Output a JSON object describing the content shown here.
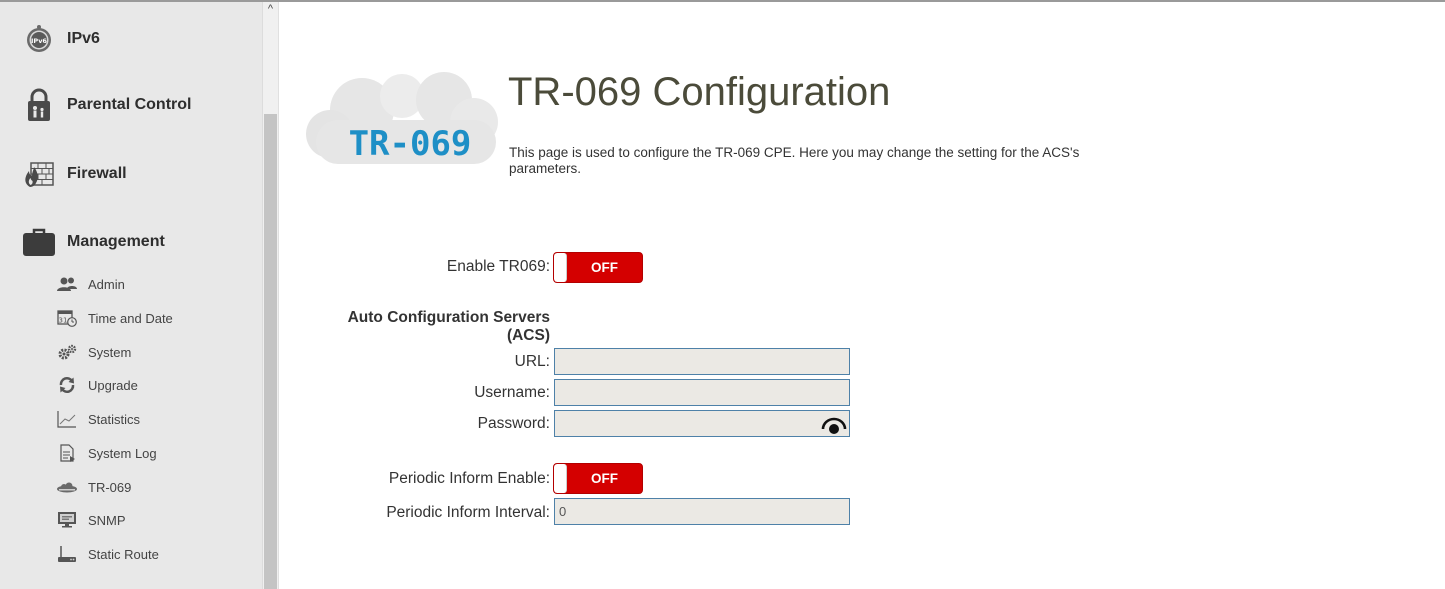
{
  "sidebar": {
    "sections": [
      {
        "label": "IPv6",
        "icon": "ipv6-globe-icon",
        "icon_text": "IPv6"
      },
      {
        "label": "Parental Control",
        "icon": "lock-family-icon"
      },
      {
        "label": "Firewall",
        "icon": "firewall-icon"
      },
      {
        "label": "Management",
        "icon": "briefcase-icon"
      }
    ],
    "management_items": [
      {
        "label": "Admin",
        "icon": "users-icon"
      },
      {
        "label": "Time and Date",
        "icon": "calendar-clock-icon",
        "icon_text": "31"
      },
      {
        "label": "System",
        "icon": "gears-icon"
      },
      {
        "label": "Upgrade",
        "icon": "refresh-icon"
      },
      {
        "label": "Statistics",
        "icon": "line-chart-icon"
      },
      {
        "label": "System Log",
        "icon": "log-file-icon"
      },
      {
        "label": "TR-069",
        "icon": "cloud-icon"
      },
      {
        "label": "SNMP",
        "icon": "monitor-icon"
      },
      {
        "label": "Static Route",
        "icon": "router-icon"
      }
    ],
    "scroll_up_glyph": "^"
  },
  "page": {
    "logo_text": "TR-069",
    "title": "TR-069 Configuration",
    "description": "This page is used to configure the TR-069 CPE. Here you may change the setting for the ACS's parameters."
  },
  "form": {
    "enable_label": "Enable TR069:",
    "enable_state": "OFF",
    "acs_heading_line1": "Auto Configuration Servers",
    "acs_heading_line2": "(ACS)",
    "url_label": "URL:",
    "url_value": "",
    "username_label": "Username:",
    "username_value": "",
    "password_label": "Password:",
    "password_value": "",
    "password_toggle_icon": "eye-icon",
    "periodic_enable_label": "Periodic Inform Enable:",
    "periodic_enable_state": "OFF",
    "periodic_interval_label": "Periodic Inform Interval:",
    "periodic_interval_value": "0"
  },
  "colors": {
    "toggle_off": "#d40000",
    "field_bg": "#ebe9e4",
    "field_border": "#4e81a8",
    "logo_text": "#1e8fc6",
    "title": "#4b4b3a",
    "sidebar_bg": "#e8e8e8"
  }
}
